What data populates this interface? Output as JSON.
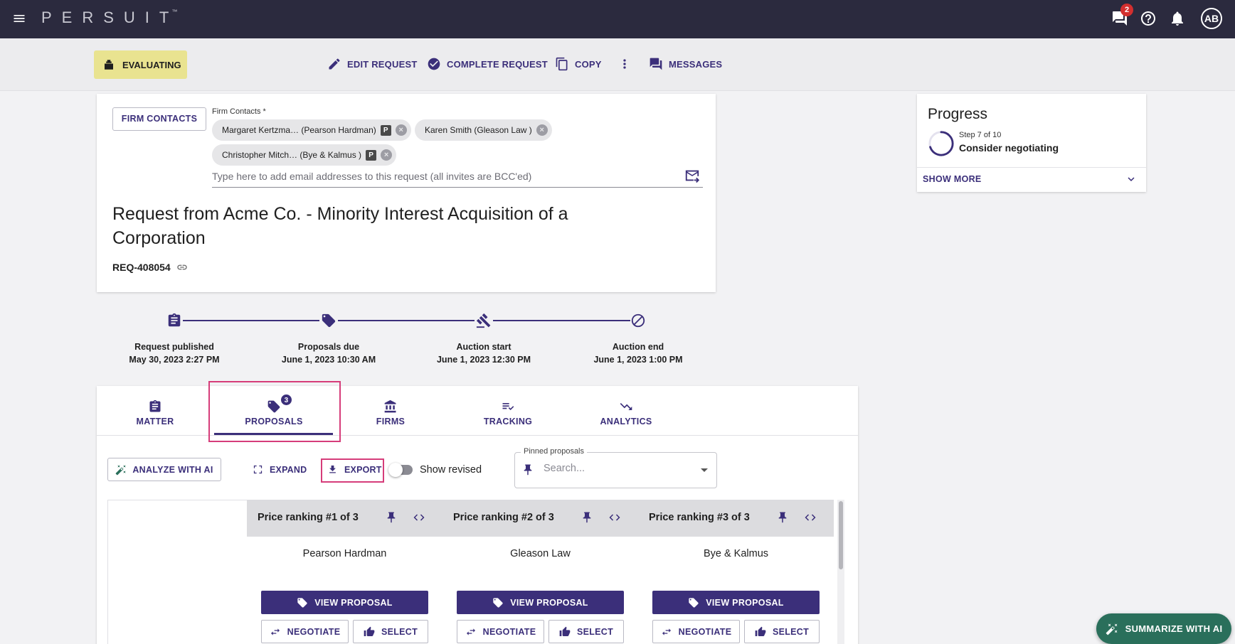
{
  "topbar": {
    "logo": "PERSUIT",
    "trademark": "™",
    "messages_badge": "2",
    "avatar": "AB",
    "icons": [
      "menu-icon",
      "chat-icon",
      "help-icon",
      "bell-icon"
    ]
  },
  "actionbar": {
    "status": "EVALUATING",
    "edit": "EDIT REQUEST",
    "complete": "COMPLETE REQUEST",
    "copy": "COPY",
    "messages": "MESSAGES"
  },
  "request": {
    "firm_contacts_button": "FIRM CONTACTS",
    "firm_contacts_label": "Firm Contacts *",
    "contacts": [
      {
        "name": "Margaret Kertzma… (Pearson Hardman)",
        "badge": "P"
      },
      {
        "name": "Karen Smith (Gleason Law )",
        "badge": ""
      },
      {
        "name": "Christopher Mitch… (Bye & Kalmus )",
        "badge": "P"
      }
    ],
    "email_placeholder": "Type here to add email addresses to this request (all invites are BCC'ed)",
    "title": "Request from Acme Co. - Minority Interest Acquisition of a Corporation",
    "id": "REQ-408054"
  },
  "timeline": [
    {
      "label": "Request published",
      "date": "May 30, 2023 2:27 PM",
      "icon": "clipboard-icon"
    },
    {
      "label": "Proposals due",
      "date": "June 1, 2023 10:30 AM",
      "icon": "tag-icon"
    },
    {
      "label": "Auction start",
      "date": "June 1, 2023 12:30 PM",
      "icon": "gavel-icon"
    },
    {
      "label": "Auction end",
      "date": "June 1, 2023 1:00 PM",
      "icon": "block-icon"
    }
  ],
  "progress": {
    "title": "Progress",
    "step": "Step 7 of 10",
    "name": "Consider negotiating",
    "show_more": "SHOW MORE",
    "fraction": 0.7
  },
  "tabs": [
    {
      "label": "MATTER",
      "badge": ""
    },
    {
      "label": "PROPOSALS",
      "badge": "3"
    },
    {
      "label": "FIRMS",
      "badge": ""
    },
    {
      "label": "TRACKING",
      "badge": ""
    },
    {
      "label": "ANALYTICS",
      "badge": ""
    }
  ],
  "active_tab": "PROPOSALS",
  "toolbar": {
    "analyze": "ANALYZE WITH AI",
    "expand": "EXPAND",
    "export": "EXPORT",
    "show_revised": "Show revised",
    "pinned_label": "Pinned proposals",
    "pinned_placeholder": "Search..."
  },
  "proposals": [
    {
      "ranking": "Price ranking #1 of 3",
      "firm": "Pearson Hardman"
    },
    {
      "ranking": "Price ranking #2 of 3",
      "firm": "Gleason Law"
    },
    {
      "ranking": "Price ranking #3 of 3",
      "firm": "Bye & Kalmus"
    }
  ],
  "proposal_actions": {
    "view": "VIEW PROPOSAL",
    "negotiate": "NEGOTIATE",
    "select": "SELECT"
  },
  "summarize": "SUMMARIZE WITH AI",
  "colors": {
    "brand": "#3b2f7a",
    "topbar": "#2b2a3e",
    "status": "#e9e390",
    "ai_green": "#2a6f5b",
    "highlight": "#d63d7a"
  }
}
